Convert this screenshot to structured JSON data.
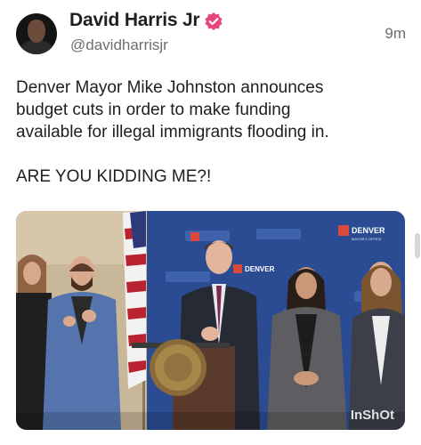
{
  "author": {
    "display_name": "David Harris Jr",
    "handle": "@davidharrisjr",
    "verified_icon": "verified-badge-icon",
    "verified_color": "#e8457c"
  },
  "post": {
    "timestamp": "9m",
    "text_lines": [
      "Denver Mayor Mike Johnston announces",
      "budget cuts in order to make funding",
      "available for illegal immigrants flooding in."
    ],
    "text_exclaim": "ARE YOU KIDDING ME?!"
  },
  "video": {
    "banner_logo_text": "DENVER",
    "banner_logo_sub": "MAYOR'S OFFICE",
    "watermark": "InShOt",
    "backdrop_color": "#2a4a8e"
  }
}
